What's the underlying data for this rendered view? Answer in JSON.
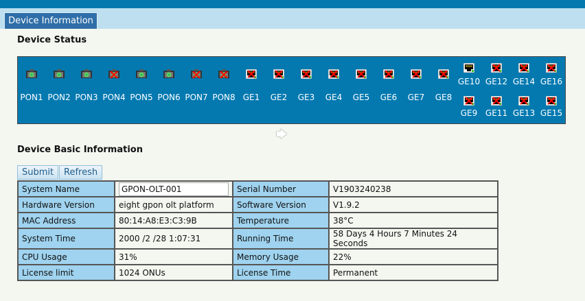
{
  "tab": "Device Information",
  "device_status": {
    "title": "Device Status",
    "ports": [
      {
        "name": "PON1",
        "type": "pon",
        "status": "up"
      },
      {
        "name": "PON2",
        "type": "pon",
        "status": "up"
      },
      {
        "name": "PON3",
        "type": "pon",
        "status": "up"
      },
      {
        "name": "PON4",
        "type": "pon",
        "status": "down"
      },
      {
        "name": "PON5",
        "type": "pon",
        "status": "up"
      },
      {
        "name": "PON6",
        "type": "pon",
        "status": "up"
      },
      {
        "name": "PON7",
        "type": "pon",
        "status": "down"
      },
      {
        "name": "PON8",
        "type": "pon",
        "status": "down"
      },
      {
        "name": "GE1",
        "type": "ge",
        "status": "down"
      },
      {
        "name": "GE2",
        "type": "ge",
        "status": "down"
      },
      {
        "name": "GE3",
        "type": "ge",
        "status": "down"
      },
      {
        "name": "GE4",
        "type": "ge",
        "status": "down"
      },
      {
        "name": "GE5",
        "type": "ge",
        "status": "down"
      },
      {
        "name": "GE6",
        "type": "ge",
        "status": "down"
      },
      {
        "name": "GE7",
        "type": "ge",
        "status": "down"
      },
      {
        "name": "GE8",
        "type": "ge",
        "status": "down"
      },
      {
        "name": "GE10",
        "type": "ge",
        "status": "up"
      },
      {
        "name": "GE12",
        "type": "ge",
        "status": "down"
      },
      {
        "name": "GE14",
        "type": "ge",
        "status": "down"
      },
      {
        "name": "GE16",
        "type": "ge",
        "status": "down"
      },
      {
        "name": "GE9",
        "type": "ge",
        "status": "down"
      },
      {
        "name": "GE11",
        "type": "ge",
        "status": "down"
      },
      {
        "name": "GE13",
        "type": "ge",
        "status": "down"
      },
      {
        "name": "GE15",
        "type": "ge",
        "status": "down"
      }
    ]
  },
  "basic": {
    "title": "Device Basic Information",
    "submit": "Submit",
    "refresh": "Refresh",
    "rows": [
      [
        "System Name",
        "GPON-OLT-001",
        "Serial Number",
        "V1903240238"
      ],
      [
        "Hardware Version",
        "eight gpon olt platform",
        "Software Version",
        "V1.9.2"
      ],
      [
        "MAC Address",
        "80:14:A8:E3:C3:9B",
        "Temperature",
        "38°C"
      ],
      [
        "System Time",
        "2000 /2 /28 1:07:31",
        "Running Time",
        "58 Days 4 Hours 7 Minutes 24 Seconds"
      ],
      [
        "CPU Usage",
        "31%",
        "Memory Usage",
        "22%"
      ],
      [
        "License limit",
        "1024 ONUs",
        "License Time",
        "Permanent"
      ]
    ]
  }
}
